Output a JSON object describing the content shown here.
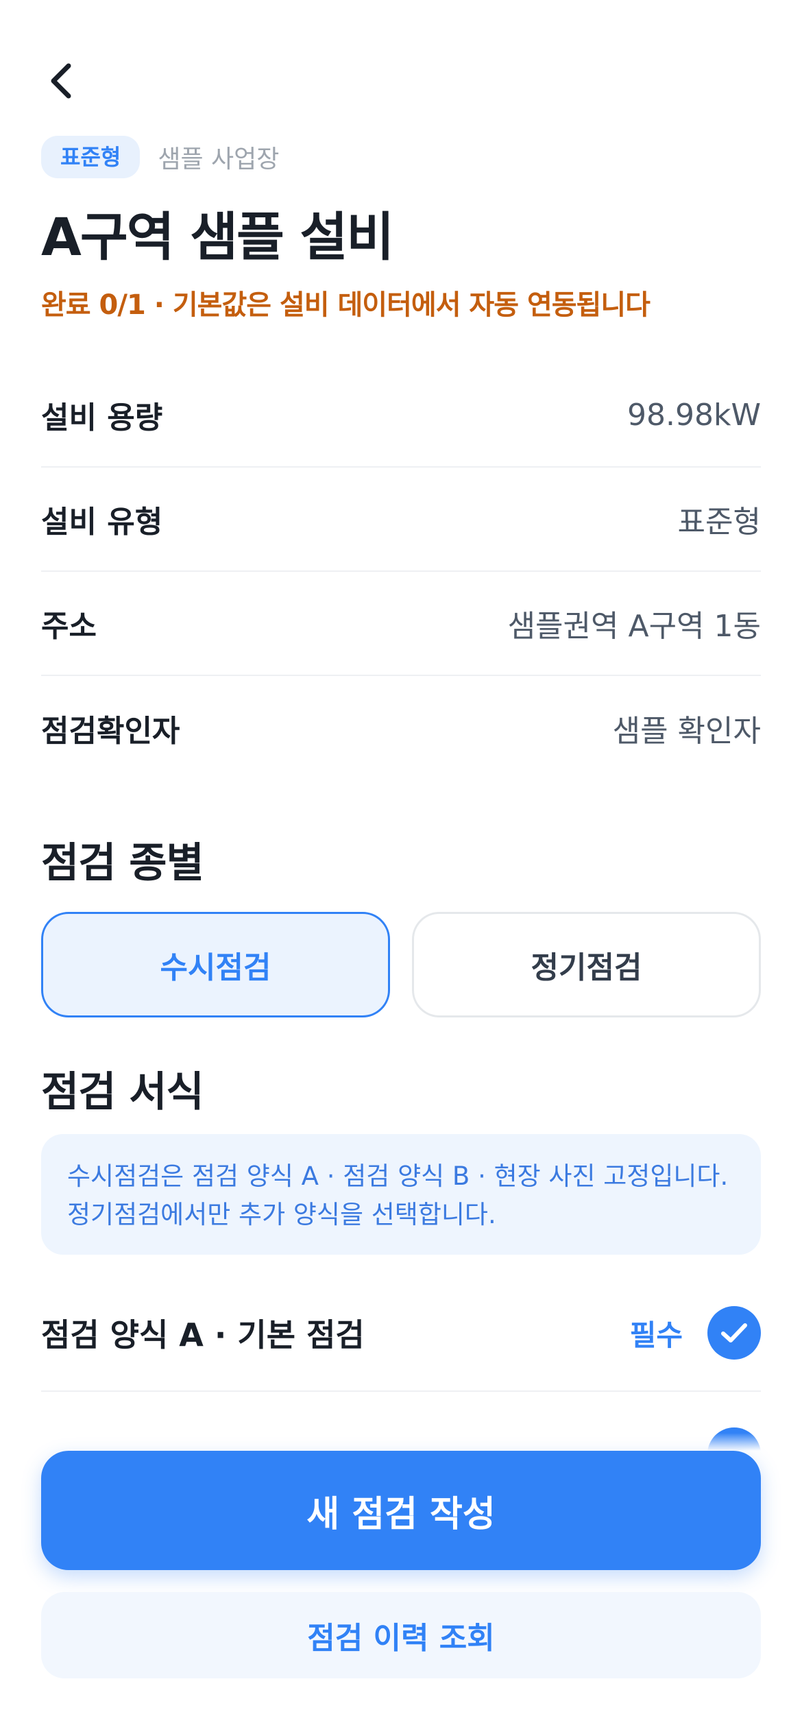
{
  "header": {
    "badge": "표준형",
    "site_name": "샘플 사업장",
    "title": "A구역 샘플 설비",
    "subtitle": "완료 0/1 · 기본값은 설비 데이터에서 자동 연동됩니다"
  },
  "info": [
    {
      "label": "설비 용량",
      "value": "98.98kW"
    },
    {
      "label": "설비 유형",
      "value": "표준형"
    },
    {
      "label": "주소",
      "value": "샘플권역 A구역 1동"
    },
    {
      "label": "점검확인자",
      "value": "샘플 확인자"
    }
  ],
  "inspection_type": {
    "title": "점검 종별",
    "options": [
      {
        "label": "수시점검",
        "selected": true
      },
      {
        "label": "정기점검",
        "selected": false
      }
    ]
  },
  "inspection_form": {
    "title": "점검 서식",
    "notice_line1": "수시점검은 점검 양식 A · 점검 양식 B · 현장 사진 고정입니다.",
    "notice_line2": "정기점검에서만 추가 양식을 선택합니다.",
    "items": [
      {
        "label": "점검 양식 A · 기본 점검",
        "tag": "필수",
        "checked": true
      }
    ]
  },
  "actions": {
    "primary": "새 점검 작성",
    "secondary": "점검 이력 조회"
  },
  "colors": {
    "accent": "#3182f6",
    "warning_text": "#c45e0e"
  }
}
